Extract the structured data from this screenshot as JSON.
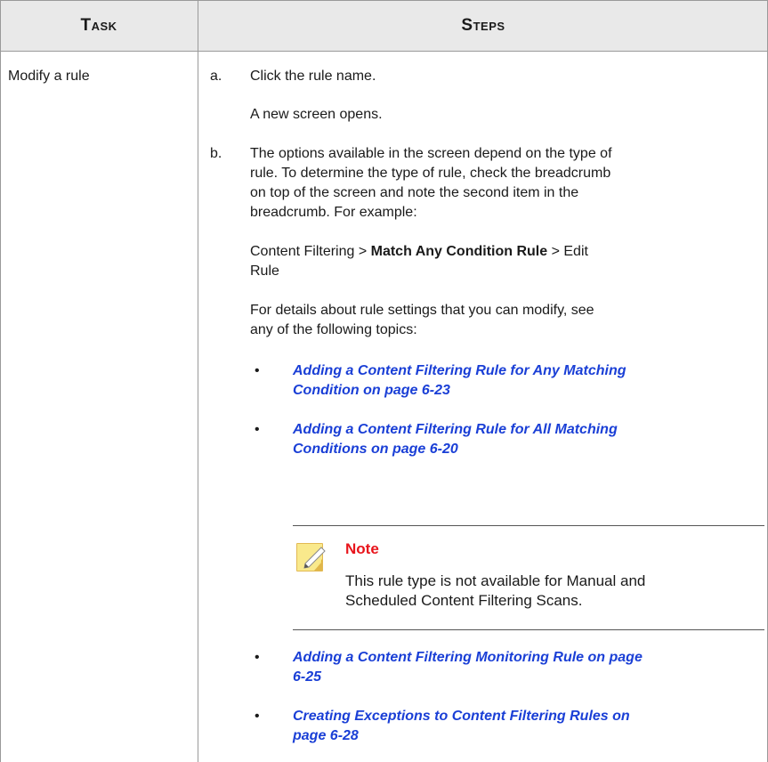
{
  "header": {
    "task": "Task",
    "steps": "Steps"
  },
  "row": {
    "task": "Modify a rule",
    "step_a": {
      "marker": "a.",
      "text": "Click the rule name."
    },
    "step_a_result": "A new screen opens.",
    "step_b": {
      "marker": "b.",
      "lines": [
        "The options available in the screen depend on the type of",
        "rule. To determine the type of rule, check the breadcrumb",
        "on top of the screen and note the second item in the",
        "breadcrumb. For example:"
      ]
    },
    "breadcrumb": {
      "prefix": "Content Filtering > ",
      "bold": "Match Any Condition Rule",
      "suffix_line1": " > Edit",
      "suffix_line2": "Rule"
    },
    "details_lines": [
      "For details about rule settings that you can modify, see",
      "any of the following topics:"
    ],
    "links": [
      {
        "line1": "Adding a Content Filtering Rule for Any Matching",
        "line2": "Condition on page 6-23"
      },
      {
        "line1": "Adding a Content Filtering Rule for All Matching",
        "line2": "Conditions on page 6-20"
      },
      {
        "line1": "Adding a Content Filtering Monitoring Rule on page",
        "line2": "6-25"
      },
      {
        "line1": "Creating Exceptions to Content Filtering Rules on",
        "line2": "page 6-28"
      }
    ],
    "note": {
      "title": "Note",
      "lines": [
        "This rule type is not available for Manual and",
        "Scheduled Content Filtering Scans."
      ]
    },
    "bullet_glyph": "•"
  },
  "colors": {
    "link": "#1a3fd6",
    "note_title": "#e8141b",
    "header_bg": "#e9e9e9",
    "border": "#9a9a9a"
  }
}
